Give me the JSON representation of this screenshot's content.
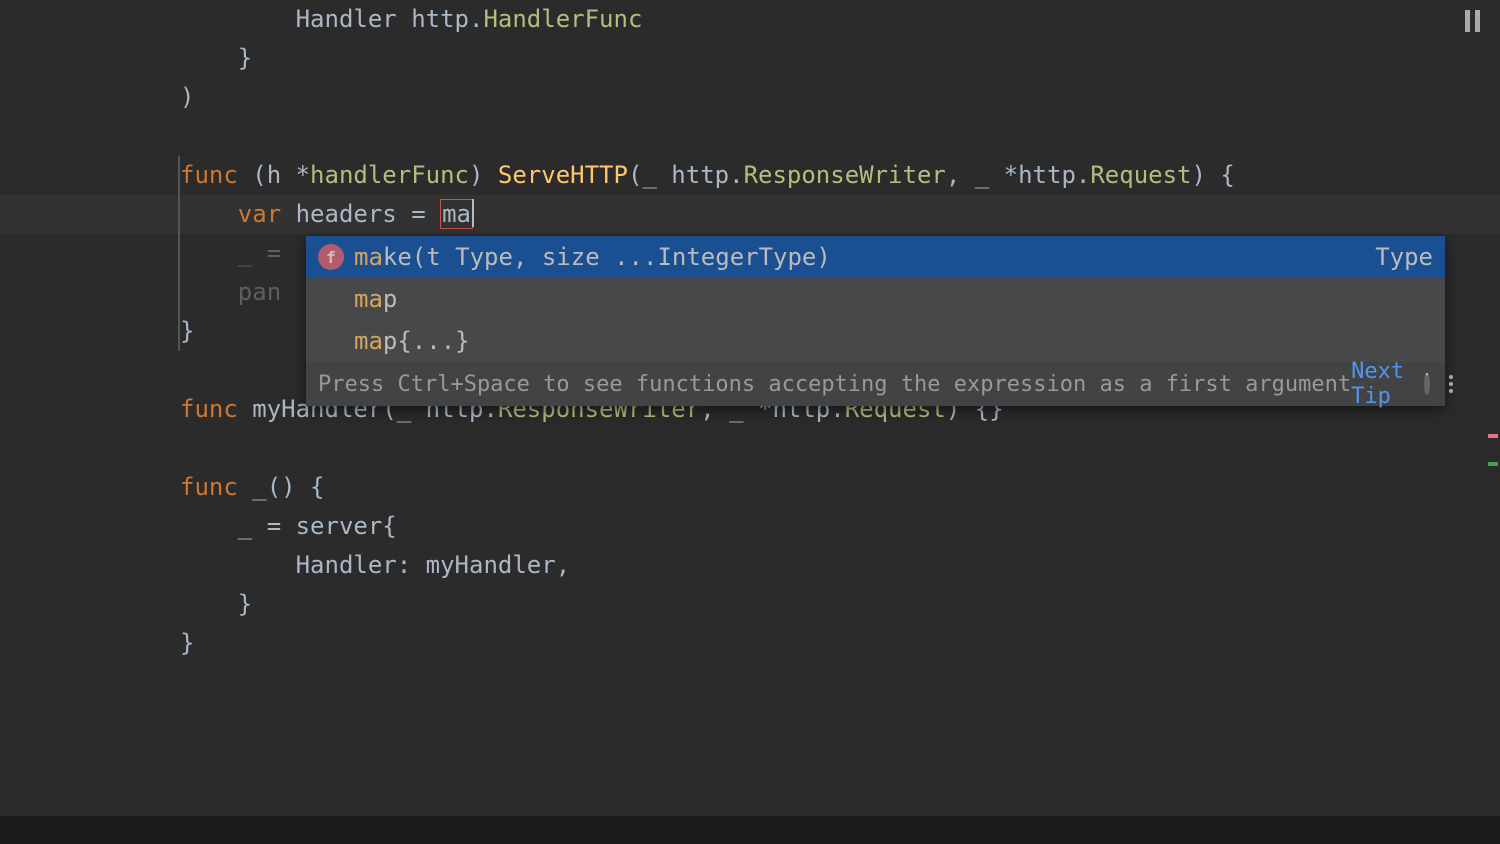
{
  "code": {
    "l1_indent": "        ",
    "l1_handler": "Handler",
    "l1_http": " http",
    "l1_handlerfunc": "HandlerFunc",
    "l2": "    }",
    "l3": ")",
    "l4": "",
    "l5_func": "func ",
    "l5_recv": "(h *",
    "l5_handlerFunc": "handlerFunc",
    "l5_paren": ") ",
    "l5_serve": "ServeHTTP",
    "l5_args1": "(_ http",
    "l5_dot1": ".",
    "l5_rw": "ResponseWriter",
    "l5_args2": ", _ *http",
    "l5_dot2": ".",
    "l5_req": "Request",
    "l5_end": ") {",
    "l6_indent": "    ",
    "l6_var": "var ",
    "l6_headers": "headers = ",
    "l6_partial": "ma",
    "l7_a": "    _ = ",
    "l8_a": "    pan",
    "l9": "}",
    "l10": "",
    "l11_func": "func ",
    "l11_name": "myHandler",
    "l11_args1": "(_ http",
    "l11_dot1": ".",
    "l11_rw": "ResponseWriter",
    "l11_args2": ", _ *http",
    "l11_dot2": ".",
    "l11_req": "Request",
    "l11_end": ") {}",
    "l12": "",
    "l13_func": "func ",
    "l13_name": "_",
    "l13_rest": "() {",
    "l14_a": "    _ = ",
    "l14_server": "server",
    "l14_brace": "{",
    "l15_a": "        Handler: ",
    "l15_my": "myHandler",
    "l15_comma": ",",
    "l16": "    }",
    "l17": "}"
  },
  "popup": {
    "items": [
      {
        "match": "ma",
        "rest": "ke(t Type, size ...IntegerType)",
        "right": "Type",
        "icon": "f"
      },
      {
        "match": "ma",
        "rest": "p",
        "right": "",
        "icon": ""
      },
      {
        "match": "ma",
        "rest": "p{...}",
        "right": "",
        "icon": ""
      }
    ],
    "hint": "Press Ctrl+Space to see functions accepting the expression as a first argument",
    "next_tip": "Next Tip"
  }
}
